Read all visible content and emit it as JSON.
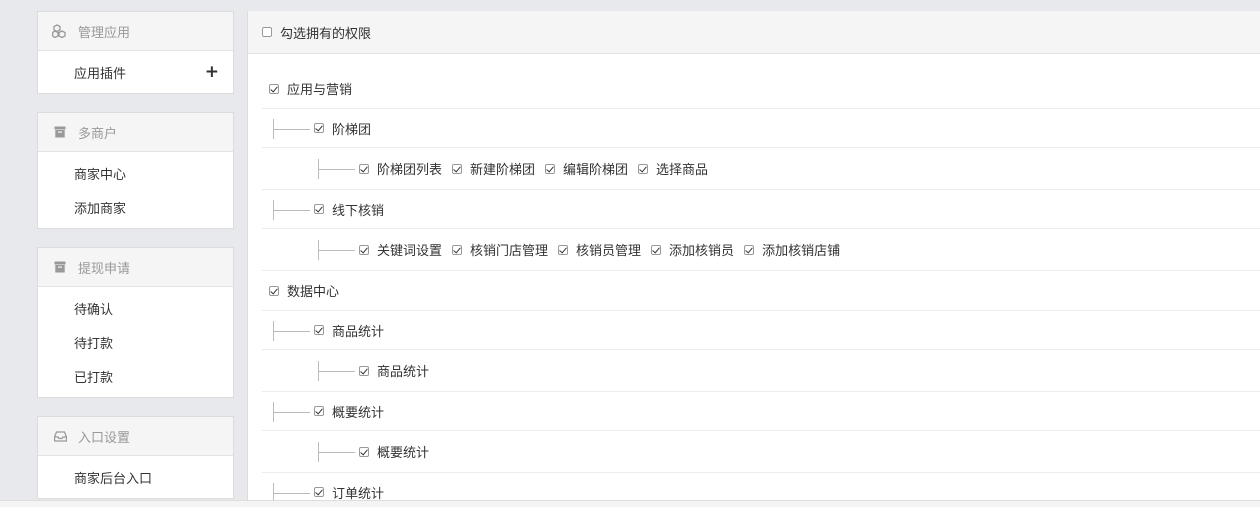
{
  "sidebar": {
    "panels": [
      {
        "title": "管理应用",
        "icon": "cubes-icon",
        "items": [
          {
            "label": "应用插件",
            "has_add": true
          }
        ]
      },
      {
        "title": "多商户",
        "icon": "archive-icon",
        "items": [
          {
            "label": "商家中心"
          },
          {
            "label": "添加商家"
          }
        ]
      },
      {
        "title": "提现申请",
        "icon": "archive-icon",
        "items": [
          {
            "label": "待确认"
          },
          {
            "label": "待打款"
          },
          {
            "label": "已打款"
          }
        ]
      },
      {
        "title": "入口设置",
        "icon": "inbox-icon",
        "items": [
          {
            "label": "商家后台入口"
          }
        ]
      }
    ],
    "add_symbol": "+"
  },
  "main": {
    "header_label": "勾选拥有的权限",
    "groups": [
      {
        "label": "应用与营销",
        "children": [
          {
            "label": "阶梯团",
            "options": [
              "阶梯团列表",
              "新建阶梯团",
              "编辑阶梯团",
              "选择商品"
            ]
          },
          {
            "label": "线下核销",
            "options": [
              "关键词设置",
              "核销门店管理",
              "核销员管理",
              "添加核销员",
              "添加核销店铺"
            ]
          }
        ]
      },
      {
        "label": "数据中心",
        "children": [
          {
            "label": "商品统计",
            "options": [
              "商品统计"
            ]
          },
          {
            "label": "概要统计",
            "options": [
              "概要统计"
            ]
          },
          {
            "label": "订单统计",
            "options": []
          }
        ]
      }
    ]
  }
}
